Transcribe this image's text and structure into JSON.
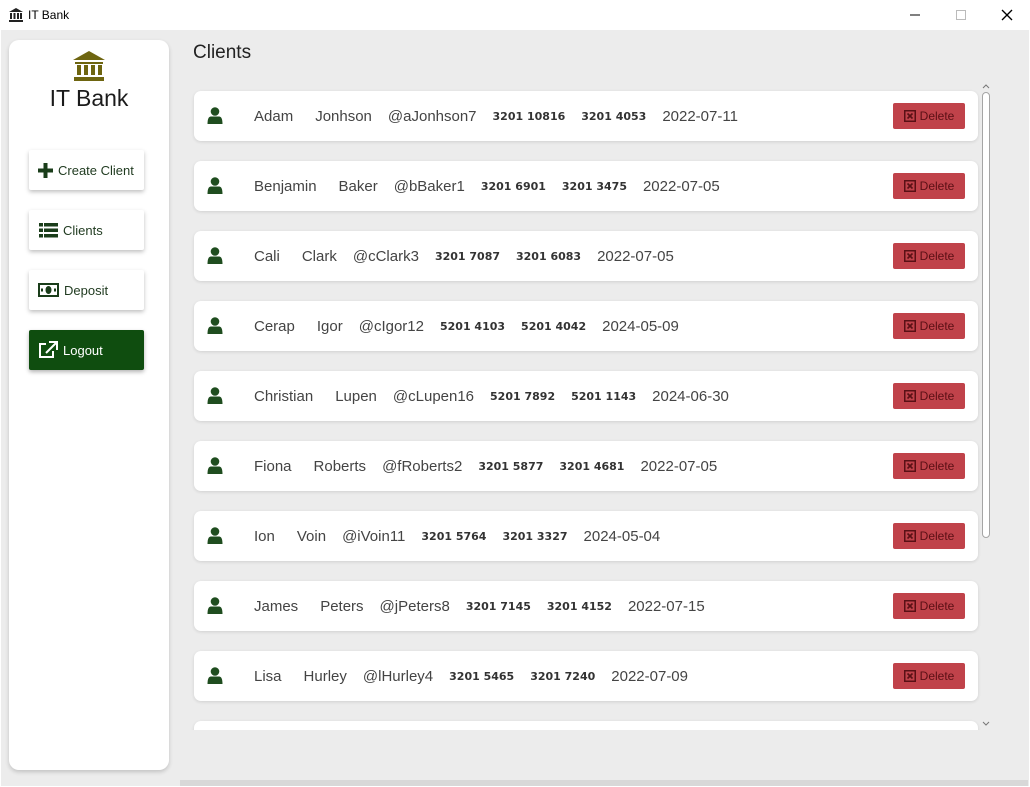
{
  "window": {
    "title": "IT Bank"
  },
  "sidebar": {
    "logo_text": "IT Bank",
    "buttons": [
      {
        "label": "Create Client",
        "icon": "plus-icon"
      },
      {
        "label": "Clients",
        "icon": "list-icon"
      },
      {
        "label": "Deposit",
        "icon": "money-icon"
      },
      {
        "label": "Logout",
        "icon": "external-link-icon"
      }
    ]
  },
  "main": {
    "title": "Clients",
    "delete_label": "Delete",
    "clients": [
      {
        "first": "Adam",
        "last": "Jonhson",
        "username": "@aJonhson7",
        "num1": "3201 10816",
        "num2": "3201 4053",
        "date": "2022-07-11"
      },
      {
        "first": "Benjamin",
        "last": "Baker",
        "username": "@bBaker1",
        "num1": "3201 6901",
        "num2": "3201 3475",
        "date": "2022-07-05"
      },
      {
        "first": "Cali",
        "last": "Clark",
        "username": "@cClark3",
        "num1": "3201 7087",
        "num2": "3201 6083",
        "date": "2022-07-05"
      },
      {
        "first": "Cerap",
        "last": "Igor",
        "username": "@cIgor12",
        "num1": "5201 4103",
        "num2": "5201 4042",
        "date": "2024-05-09"
      },
      {
        "first": "Christian",
        "last": "Lupen",
        "username": "@cLupen16",
        "num1": "5201 7892",
        "num2": "5201 1143",
        "date": "2024-06-30"
      },
      {
        "first": "Fiona",
        "last": "Roberts",
        "username": "@fRoberts2",
        "num1": "3201 5877",
        "num2": "3201 4681",
        "date": "2022-07-05"
      },
      {
        "first": "Ion",
        "last": "Voin",
        "username": "@iVoin11",
        "num1": "3201 5764",
        "num2": "3201 3327",
        "date": "2024-05-04"
      },
      {
        "first": "James",
        "last": "Peters",
        "username": "@jPeters8",
        "num1": "3201 7145",
        "num2": "3201 4152",
        "date": "2022-07-15"
      },
      {
        "first": "Lisa",
        "last": "Hurley",
        "username": "@lHurley4",
        "num1": "3201 5465",
        "num2": "3201 7240",
        "date": "2022-07-09"
      }
    ]
  },
  "colors": {
    "brand_green": "#0f4d0f",
    "icon_green": "#1f4d1f",
    "logo_olive": "#6e6510",
    "delete_red": "#c0424a",
    "delete_text": "#5a1015",
    "background": "#ececec"
  }
}
